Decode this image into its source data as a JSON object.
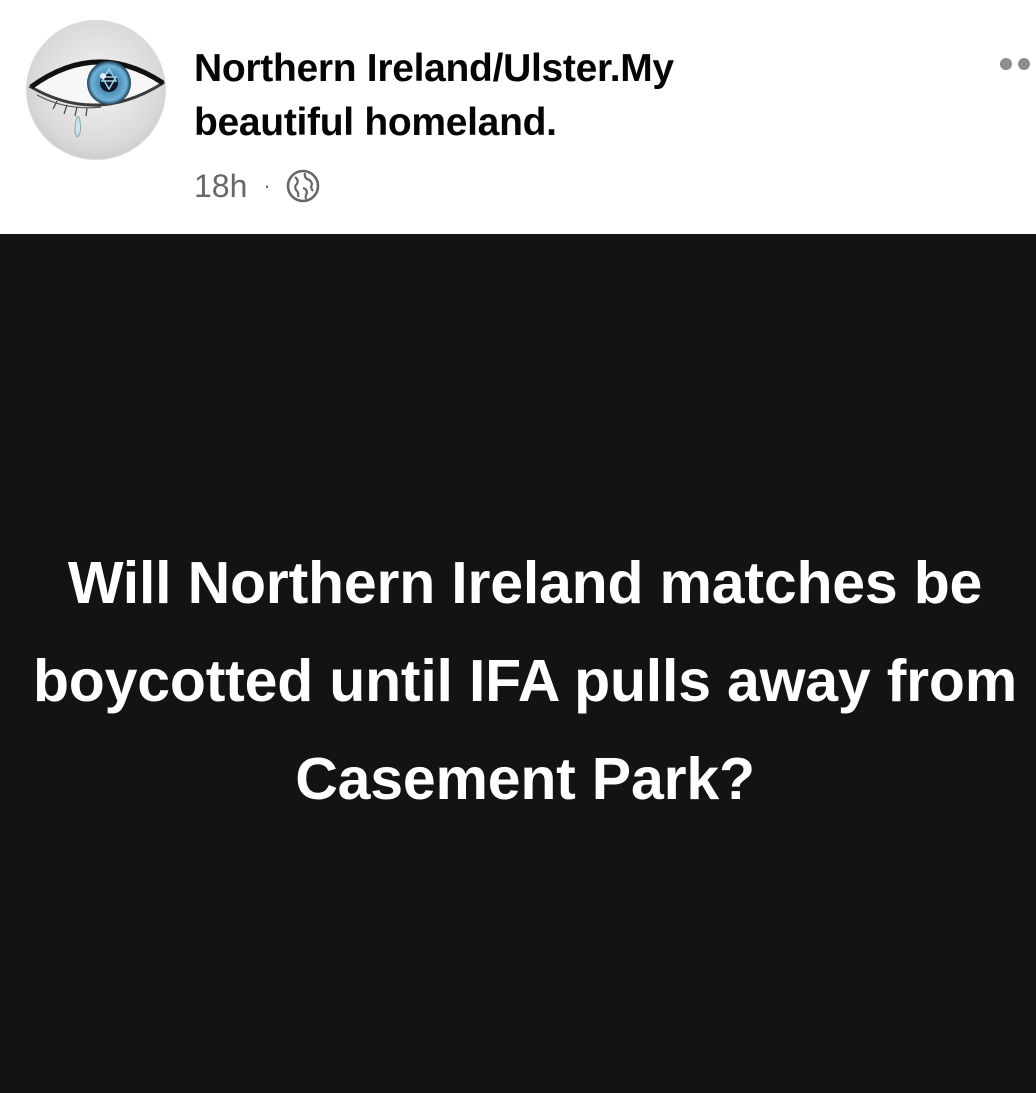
{
  "header": {
    "page_name": "Northern Ireland/Ulster.My beautiful homeland.",
    "timestamp": "18h",
    "separator": "·",
    "audience_icon": "globe-icon",
    "more_icon": "more-options-icon"
  },
  "post": {
    "text": "Will Northern Ireland matches be boycotted until IFA pulls away from Casement Park?"
  },
  "colors": {
    "header_background": "#ffffff",
    "post_background": "#131313",
    "post_text": "#ffffff",
    "name_text": "#050505",
    "meta_text": "#65676b"
  }
}
